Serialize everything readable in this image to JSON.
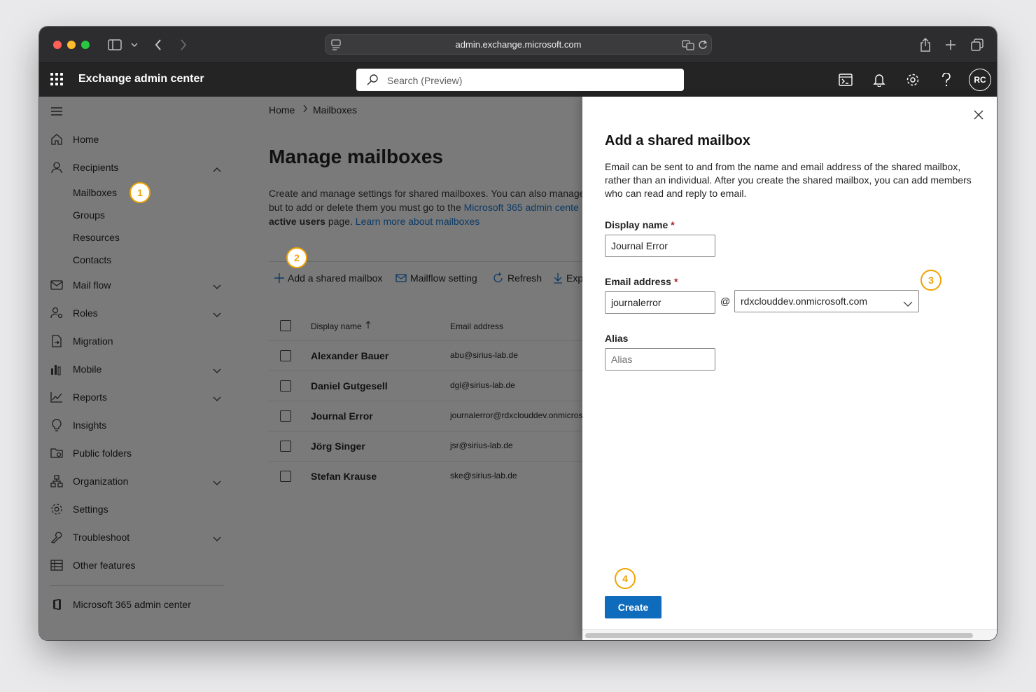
{
  "browser": {
    "url": "admin.exchange.microsoft.com"
  },
  "app": {
    "title": "Exchange admin center",
    "search_placeholder": "Search (Preview)",
    "avatar_initials": "RC"
  },
  "sidebar": {
    "items": [
      {
        "label": "Home",
        "icon": "home-icon"
      },
      {
        "label": "Recipients",
        "icon": "person-icon",
        "expanded": true
      },
      {
        "label": "Mail flow",
        "icon": "mail-icon"
      },
      {
        "label": "Roles",
        "icon": "roles-icon"
      },
      {
        "label": "Migration",
        "icon": "migration-icon"
      },
      {
        "label": "Mobile",
        "icon": "mobile-icon"
      },
      {
        "label": "Reports",
        "icon": "chart-icon"
      },
      {
        "label": "Insights",
        "icon": "lightbulb-icon"
      },
      {
        "label": "Public folders",
        "icon": "folder-icon"
      },
      {
        "label": "Organization",
        "icon": "org-icon"
      },
      {
        "label": "Settings",
        "icon": "gear-icon"
      },
      {
        "label": "Troubleshoot",
        "icon": "wrench-icon"
      },
      {
        "label": "Other features",
        "icon": "grid-icon"
      }
    ],
    "recipients_sub": [
      "Mailboxes",
      "Groups",
      "Resources",
      "Contacts"
    ],
    "footer_link": "Microsoft 365 admin center"
  },
  "main": {
    "breadcrumb": [
      "Home",
      "Mailboxes"
    ],
    "title": "Manage mailboxes",
    "desc_line1": "Create and manage settings for shared mailboxes. You can also manage s",
    "desc_line2_a": "but to add or delete them you must go to the ",
    "desc_line2_link": "Microsoft 365 admin cente",
    "desc_line3_bold": "active users",
    "desc_line3_b": " page. ",
    "desc_line3_link": "Learn more about mailboxes",
    "commands": {
      "add": "Add a shared mailbox",
      "mailflow": "Mailflow setting",
      "refresh": "Refresh",
      "export": "Expo"
    },
    "table": {
      "col_name": "Display name",
      "col_email": "Email address",
      "rows": [
        {
          "name": "Alexander Bauer",
          "email": "abu@sirius-lab.de"
        },
        {
          "name": "Daniel Gutgesell",
          "email": "dgl@sirius-lab.de"
        },
        {
          "name": "Journal Error",
          "email": "journalerror@rdxclouddev.onmicros"
        },
        {
          "name": "Jörg Singer",
          "email": "jsr@sirius-lab.de"
        },
        {
          "name": "Stefan Krause",
          "email": "ske@sirius-lab.de"
        }
      ]
    }
  },
  "panel": {
    "title": "Add a shared mailbox",
    "description": "Email can be sent to and from the name and email address of the shared mailbox, rather than an individual. After you create the shared mailbox, you can add members who can read and reply to email.",
    "display_name_label": "Display name",
    "display_name_value": "Journal Error",
    "email_label": "Email address",
    "email_value": "journalerror",
    "at_sign": "@",
    "domain_value": "rdxclouddev.onmicrosoft.com",
    "alias_label": "Alias",
    "alias_placeholder": "Alias",
    "required_mark": "*",
    "create_label": "Create"
  },
  "callouts": [
    "1",
    "2",
    "3",
    "4"
  ],
  "colors": {
    "accent": "#0f6cbd",
    "callout": "#f0a400",
    "header": "#242424"
  }
}
